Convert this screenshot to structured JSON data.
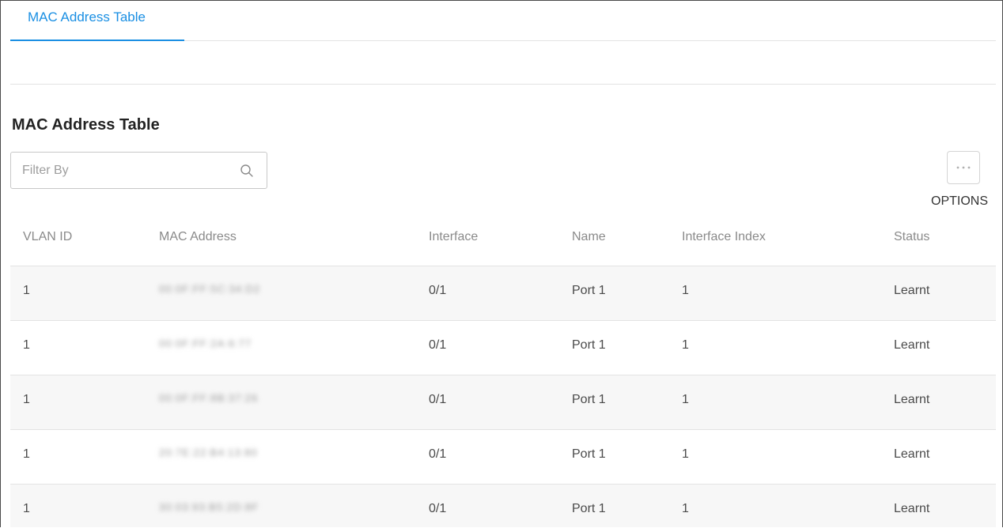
{
  "tabs": [
    {
      "label": "MAC Address Table",
      "active": true
    }
  ],
  "section_title": "MAC Address Table",
  "filter": {
    "placeholder": "Filter By",
    "value": ""
  },
  "options": {
    "label": "OPTIONS",
    "icon": "more-dots-icon"
  },
  "icons": {
    "search": "search-icon"
  },
  "colors": {
    "accent": "#1a8fe3",
    "row_alt": "#f7f7f7",
    "divider": "#e3e3e3"
  },
  "table": {
    "columns": [
      "VLAN ID",
      "MAC Address",
      "Interface",
      "Name",
      "Interface Index",
      "Status"
    ],
    "rows": [
      {
        "vlan_id": "1",
        "mac_address": "",
        "interface": "0/1",
        "name": "Port 1",
        "interface_index": "1",
        "status": "Learnt"
      },
      {
        "vlan_id": "1",
        "mac_address": "",
        "interface": "0/1",
        "name": "Port 1",
        "interface_index": "1",
        "status": "Learnt"
      },
      {
        "vlan_id": "1",
        "mac_address": "",
        "interface": "0/1",
        "name": "Port 1",
        "interface_index": "1",
        "status": "Learnt"
      },
      {
        "vlan_id": "1",
        "mac_address": "",
        "interface": "0/1",
        "name": "Port 1",
        "interface_index": "1",
        "status": "Learnt"
      },
      {
        "vlan_id": "1",
        "mac_address": "",
        "interface": "0/1",
        "name": "Port 1",
        "interface_index": "1",
        "status": "Learnt"
      }
    ]
  }
}
